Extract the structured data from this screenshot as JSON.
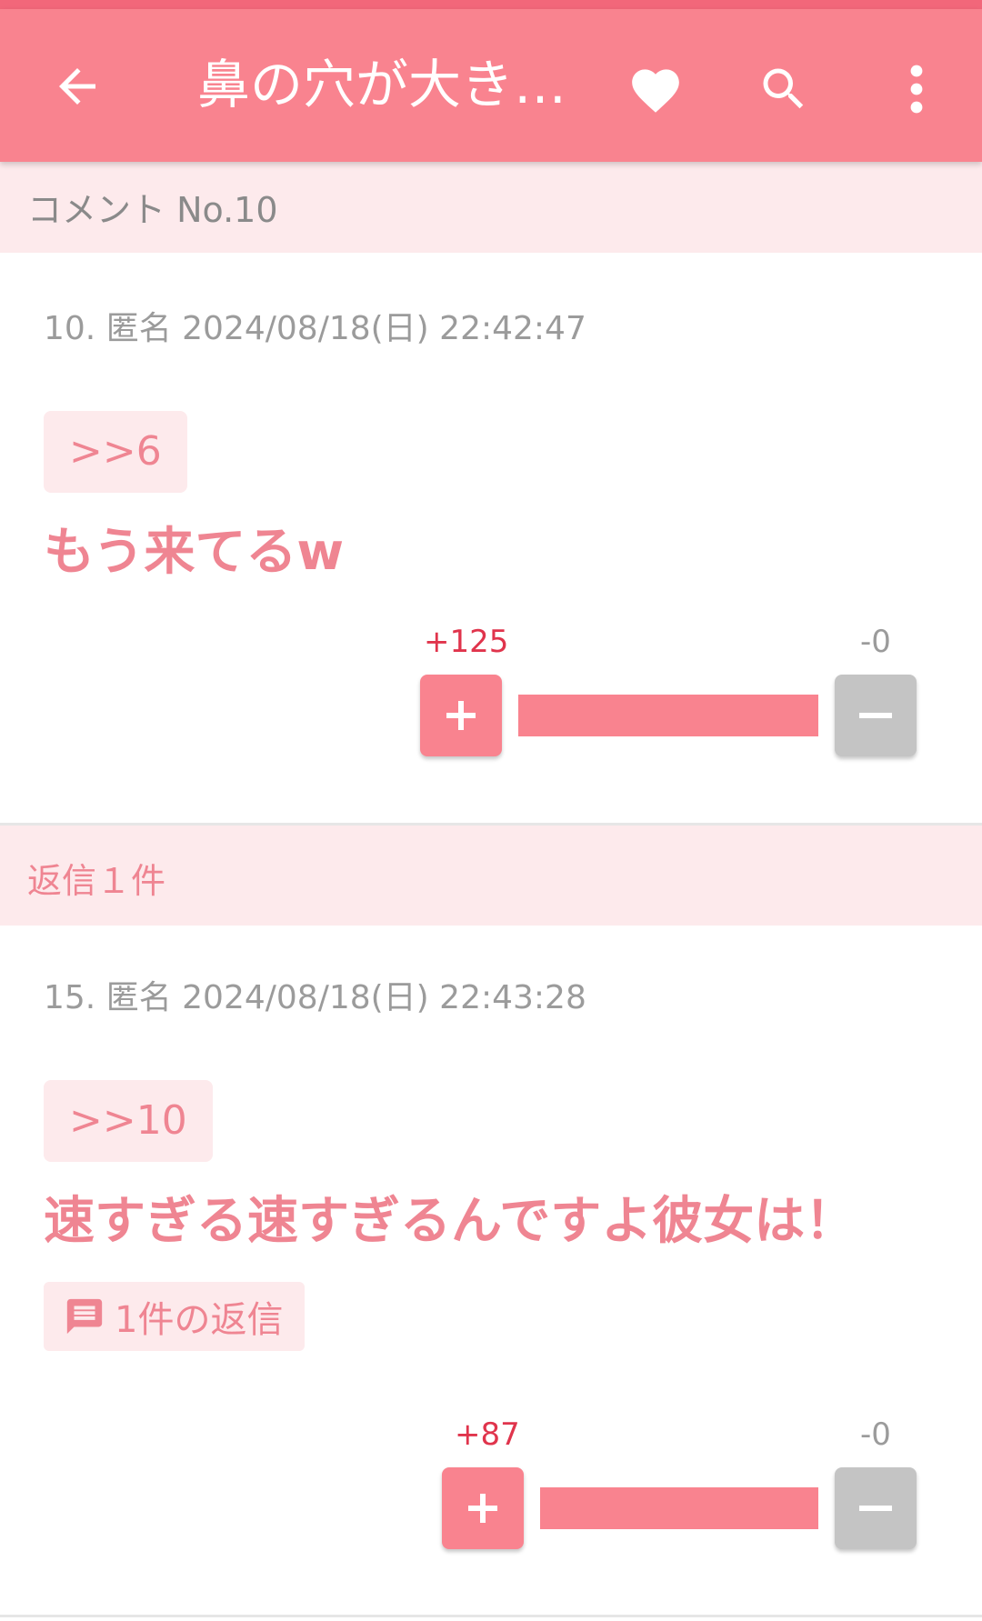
{
  "appbar": {
    "title": "鼻の穴が大き…",
    "icons": [
      "back-arrow-icon",
      "heart-icon",
      "search-icon",
      "more-vert-icon"
    ]
  },
  "section_comment": {
    "label": "コメント No.10"
  },
  "comment": {
    "meta": "10. 匿名 2024/08/18(日) 22:42:47",
    "anchor": ">>6",
    "text": "もう来てるw",
    "plus_count": "+125",
    "minus_count": "-0",
    "plus_fraction": 1.0
  },
  "section_replies": {
    "label": "返信１件"
  },
  "reply": {
    "meta": "15. 匿名 2024/08/18(日) 22:43:28",
    "anchor": ">>10",
    "text": "速すぎる速すぎるんですよ彼女は！",
    "reply_button_label": "1件の返信",
    "plus_count": "+87",
    "minus_count": "-0",
    "plus_fraction": 1.0
  },
  "colors": {
    "accent": "#f9838f",
    "accent_dark": "#f2677a",
    "tint": "#fdeaec",
    "plus_text": "#e0344c",
    "minus": "#c4c4c4"
  }
}
